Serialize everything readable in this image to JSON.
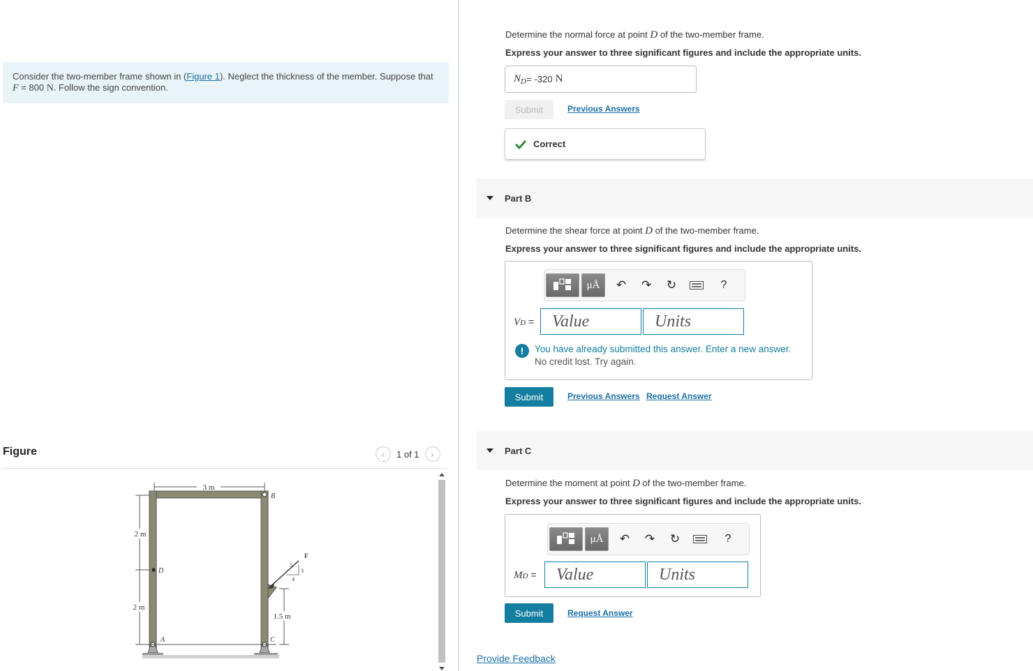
{
  "problem": {
    "prefix": "Consider the two-member frame shown in (",
    "figure_link": "Figure 1",
    "suffix": "). Neglect the thickness of the member. Suppose that",
    "line2_var": "F",
    "line2_eq": " = 800 ",
    "line2_unit": "N",
    "line2_rest": ". Follow the sign convention."
  },
  "figure": {
    "title": "Figure",
    "pager": "1 of 1",
    "labels": {
      "dim_top": "3 m",
      "point_b": "B",
      "point_d": "D",
      "point_a": "A",
      "point_c": "C",
      "dim_2m_upper": "2 m",
      "dim_2m_lower": "2 m",
      "dim_15m": "1.5 m",
      "force": "F",
      "slope_5": "5",
      "slope_3": "3",
      "slope_4": "4"
    }
  },
  "partA": {
    "q_prefix": "Determine the normal force at point ",
    "q_var": "D",
    "q_suffix": " of the two-member frame.",
    "instruction": "Express your answer to three significant figures and include the appropriate units.",
    "answer_var": "N",
    "answer_sub": "D",
    "answer_eq": " = ",
    "answer_value": "-320",
    "answer_unit": "N",
    "submit_label": "Submit",
    "previous_answers": "Previous Answers",
    "feedback": "Correct"
  },
  "partB": {
    "title": "Part B",
    "q_prefix": "Determine the shear force at point ",
    "q_var": "D",
    "q_suffix": " of the two-member frame.",
    "instruction": "Express your answer to three significant figures and include the appropriate units.",
    "var": "V",
    "var_sub": "D",
    "var_eq": " =",
    "value_placeholder": "Value",
    "units_placeholder": "Units",
    "warning_line1": "You have already submitted this answer. Enter a new answer.",
    "warning_line2": "No credit lost. Try again.",
    "submit_label": "Submit",
    "previous_answers": "Previous Answers",
    "request_answer": "Request Answer"
  },
  "partC": {
    "title": "Part C",
    "q_prefix": "Determine the moment at point ",
    "q_var": "D",
    "q_suffix": " of the two-member frame.",
    "instruction": "Express your answer to three significant figures and include the appropriate units.",
    "var": "M",
    "var_sub": "D",
    "var_eq": " =",
    "value_placeholder": "Value",
    "units_placeholder": "Units",
    "submit_label": "Submit",
    "request_answer": "Request Answer"
  },
  "toolbar": {
    "mu_label": "μÅ",
    "help_label": "?",
    "icons": [
      "templates-icon",
      "units-mu-icon",
      "undo-icon",
      "redo-icon",
      "reset-icon",
      "keyboard-icon",
      "help-icon"
    ]
  },
  "footer": {
    "feedback_link": "Provide Feedback"
  },
  "colors": {
    "accent": "#137ea0",
    "link": "#1a6fa8",
    "problem_bg": "#e8f4f7",
    "correct_check": "#2e8b3d"
  }
}
